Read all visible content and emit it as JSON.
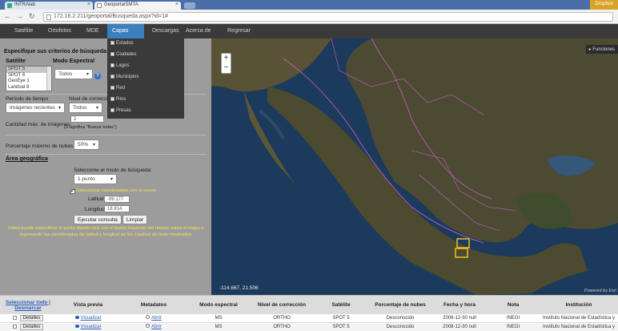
{
  "browser": {
    "tabs": [
      {
        "label": "INTRAlab"
      },
      {
        "label": "GeoportalSMTA"
      }
    ],
    "url": "172.16.2.211/geoportal/Busqueda.aspx?id=1#",
    "user_badge": "Dropbox"
  },
  "menu": {
    "items": [
      "Satélite",
      "Ortofotos",
      "MDE",
      "Capas",
      "Descargas",
      "Acerca de",
      "Regresar"
    ],
    "active": "Capas"
  },
  "layers_dropdown": {
    "items": [
      "Estados",
      "Ciudades",
      "Lagos",
      "Municipios",
      "Red",
      "Ríos",
      "Presas"
    ]
  },
  "panel": {
    "criteria_title": "Especifique sus criterios de búsqueda:",
    "satellite_label": "Satélite",
    "satellites": [
      "SPOT 5",
      "SPOT 6",
      "GeoEye 1",
      "Landsat 8"
    ],
    "spectral_mode_label": "Modo Espectral",
    "spectral_mode_value": "Todos",
    "time_period_label": "Período de tiempo",
    "time_period_value": "Imágenes recientes",
    "correction_label": "Nivel de corrección",
    "correction_value": "Todos",
    "max_images_label": "Cantidad máx. de imágenes",
    "max_images_value": "2",
    "max_images_hint": "(0 significa \"Buscar todas\")",
    "clouds_label": "Porcentaje máximo de nubes",
    "clouds_value": "50%",
    "geo_area_label": "Área geográfica",
    "mode_prompt": "Seleccione el modo de búsqueda",
    "mode_value": "1 punto",
    "cursor_coords_label": "Seleccionar coordenadas con el cursor",
    "lat_label": "Latitud",
    "lat_value": "-99.177",
    "lon_label": "Longitud",
    "lon_value": "18.814",
    "run_button": "Ejecutar consulta",
    "clear_button": "Limpiar",
    "help_text_1": "Usted puede especificar el punto dando click con el botón izquierdo del mouse sobre el mapa o",
    "help_text_2": "ingresando las coordenadas de latitud y longitud en los cuadros de texto mostrados",
    "help_q": "?"
  },
  "map": {
    "zoom_in": "+",
    "zoom_out": "−",
    "coords_readout": "-114.667, 21.506",
    "functions_label": "▸ Funciones",
    "credit": "Powered by Esri"
  },
  "table": {
    "select_all": "Seleccionar todo |",
    "deselect": "Desmarcar",
    "headers": [
      "Vista previa",
      "Metadatos",
      "Modo espectral",
      "Nivel de corrección",
      "Satélite",
      "Porcentaje de nubes",
      "Fecha y hora",
      "Nota",
      "Institución"
    ],
    "rows": [
      {
        "detail": "Detalles",
        "preview": "Visualizar",
        "meta": "Abrir",
        "mode": "MS",
        "level": "ORTHO",
        "sat": "SPOT 5",
        "clouds": "Desconocido",
        "date": "2008-12-30 null",
        "note": "INEGI",
        "inst": "Instituto Nacional de Estadística y"
      },
      {
        "detail": "Detalles",
        "preview": "Visualizar",
        "meta": "Abrir",
        "mode": "MS",
        "level": "ORTHO",
        "sat": "SPOT 5",
        "clouds": "Desconocido",
        "date": "2008-12-30 null",
        "note": "INEGI",
        "inst": "Instituto Nacional de Estadística y"
      }
    ]
  }
}
